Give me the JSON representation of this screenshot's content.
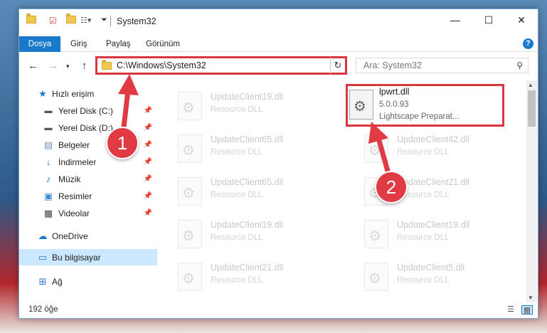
{
  "window": {
    "title": "System32"
  },
  "ribbon": {
    "tabs": [
      {
        "label": "Dosya",
        "active": true
      },
      {
        "label": "Giriş"
      },
      {
        "label": "Paylaş"
      },
      {
        "label": "Görünüm"
      }
    ],
    "help": "?"
  },
  "nav": {
    "address": "C:\\Windows\\System32",
    "search_placeholder": "Ara: System32"
  },
  "sidebar": {
    "items": [
      {
        "label": "Hızlı erişim",
        "icon": "star-icon"
      },
      {
        "label": "Yerel Disk (C:)",
        "icon": "drive-icon",
        "pinned": true
      },
      {
        "label": "Yerel Disk (D:)",
        "icon": "drive-icon",
        "pinned": true
      },
      {
        "label": "Belgeler",
        "icon": "documents-icon",
        "pinned": true
      },
      {
        "label": "İndirmeler",
        "icon": "downloads-icon",
        "pinned": true
      },
      {
        "label": "Müzik",
        "icon": "music-icon",
        "pinned": true
      },
      {
        "label": "Resimler",
        "icon": "pictures-icon",
        "pinned": true
      },
      {
        "label": "Videolar",
        "icon": "videos-icon",
        "pinned": true
      },
      {
        "label": "OneDrive",
        "icon": "cloud-icon"
      },
      {
        "label": "Bu bilgisayar",
        "icon": "computer-icon",
        "selected": true
      },
      {
        "label": "Ağ",
        "icon": "network-icon"
      }
    ]
  },
  "files": {
    "highlighted": {
      "name": "lpwrt.dll",
      "version": "5.0.0.93",
      "description": "Lightscape Preparat..."
    },
    "faded": [
      {
        "name": "UpdateClient19.dll",
        "desc": "Resource DLL"
      },
      {
        "name": "UpdateClient65.dll",
        "desc": "Resource DLL"
      },
      {
        "name": "UpdateClient42.dll",
        "desc": "Resource DLL"
      },
      {
        "name": "UpdateClient65.dll",
        "desc": "Resource DLL"
      },
      {
        "name": "UpdateClient21.dll",
        "desc": "Resource DLL"
      },
      {
        "name": "UpdateClient19.dll",
        "desc": "Resource DLL"
      },
      {
        "name": "UpdateClient19.dll",
        "desc": "Resource DLL"
      },
      {
        "name": "UpdateClient21.dll",
        "desc": "Resource DLL"
      },
      {
        "name": "UpdateClient5.dll",
        "desc": "Resource DLL"
      }
    ]
  },
  "status": {
    "item_count": "192 öğe"
  },
  "callouts": {
    "step1": "1",
    "step2": "2",
    "color": "#e03a45"
  }
}
